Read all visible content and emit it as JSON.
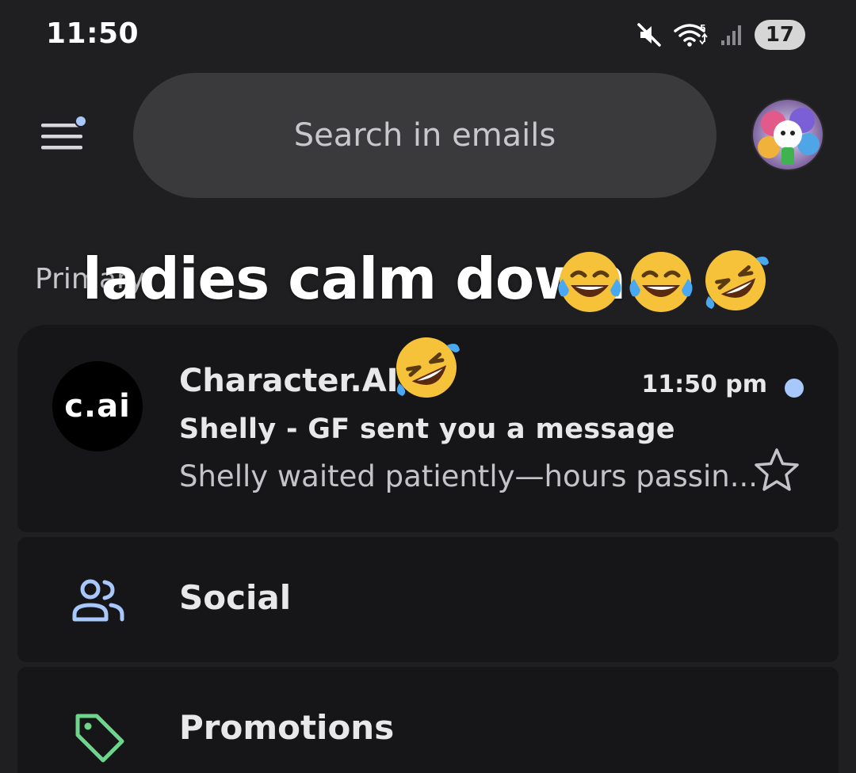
{
  "status_bar": {
    "time": "11:50",
    "battery": "17",
    "icons": [
      "mute-icon",
      "wifi-icon",
      "signal-icon"
    ]
  },
  "top_bar": {
    "menu_icon": "hamburger-menu-icon",
    "search_placeholder": "Search in emails",
    "avatar": "user-avatar"
  },
  "section": {
    "label": "Primary"
  },
  "overlay": {
    "caption": "ladies calm down",
    "emojis": [
      "face-with-tears-of-joy",
      "face-with-tears-of-joy",
      "rolling-on-the-floor-laughing",
      "rolling-on-the-floor-laughing"
    ]
  },
  "inbox": {
    "messages": [
      {
        "sender_logo_text": "c.ai",
        "sender": "Character.AI",
        "time": "11:50 pm",
        "unread": true,
        "subject": "Shelly - GF sent you a message",
        "snippet": "Shelly waited patiently—hours passin...",
        "starred": false
      }
    ],
    "categories": [
      {
        "label": "Social",
        "icon": "social-people-icon",
        "color": "#a8c7fa"
      },
      {
        "label": "Promotions",
        "icon": "tag-icon",
        "color": "#6dd58c"
      }
    ]
  },
  "colors": {
    "background": "#1f1f21",
    "card": "#161618",
    "search_bar": "#3a3a3d",
    "accent_blue": "#a8c7fa",
    "accent_green": "#6dd58c"
  }
}
